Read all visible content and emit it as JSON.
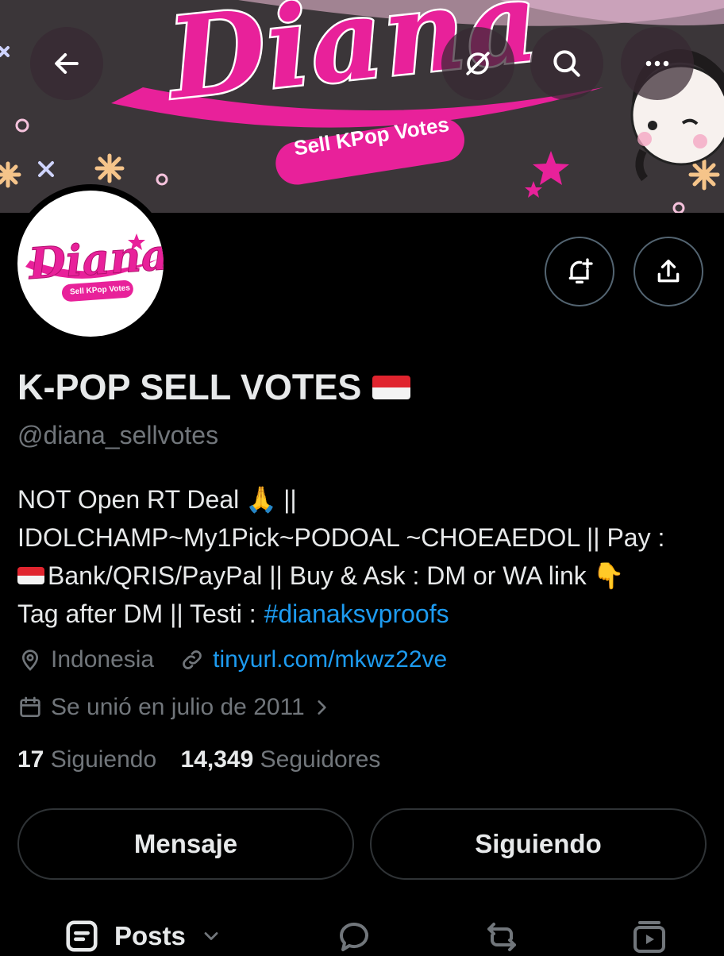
{
  "banner": {
    "brand_text": "Diana",
    "tagline": "Sell KPop Votes"
  },
  "avatar": {
    "brand_text": "Diana",
    "tagline": "Sell KPop Votes"
  },
  "profile": {
    "name": "K-POP SELL VOTES",
    "handle": "@diana_sellvotes",
    "bio_line1": "NOT Open RT Deal",
    "bio_line1_end": "||",
    "bio_line2": "IDOLCHAMP~My1Pick~PODOAL ~CHOEAEDOL || Pay :",
    "bio_line3": "Bank/QRIS/PayPal || Buy & Ask : DM or WA link",
    "bio_line4_prefix": "Tag after DM || Testi :",
    "bio_hashtag": "#dianaksvproofs",
    "location": "Indonesia",
    "website": "tinyurl.com/mkwz22ve",
    "joined": "Se unió en julio de 2011"
  },
  "stats": {
    "following_count": "17",
    "following_label": "Siguiendo",
    "followers_count": "14,349",
    "followers_label": "Seguidores"
  },
  "actions": {
    "message_label": "Mensaje",
    "following_label": "Siguiendo"
  },
  "tabs": {
    "posts_label": "Posts"
  },
  "icons": {
    "back": "back-arrow-icon",
    "grok": "grok-icon",
    "search": "search-icon",
    "more": "more-icon",
    "notify": "bell-plus-icon",
    "share": "share-icon",
    "location": "location-pin-icon",
    "link": "link-icon",
    "calendar": "calendar-icon"
  },
  "colors": {
    "accent": "#1d9bf0",
    "brand_pink": "#e8219a",
    "muted": "#71767b"
  }
}
